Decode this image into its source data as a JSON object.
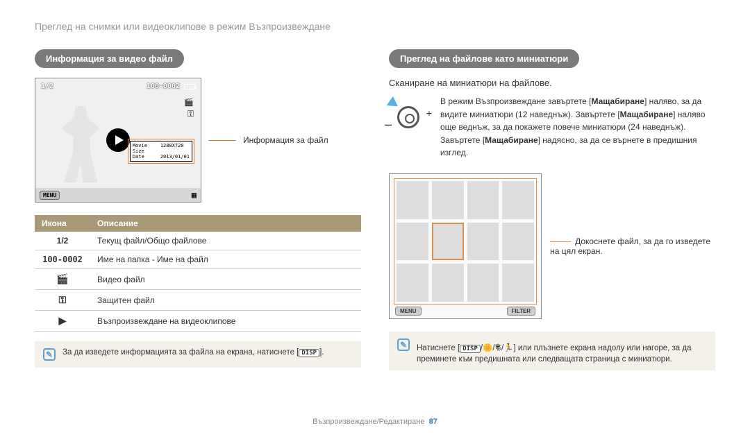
{
  "header": {
    "title": "Преглед на снимки или видеоклипове в режим Възпроизвеждане"
  },
  "left": {
    "section_title": "Информация за видео файл",
    "screen": {
      "counter": "1/2",
      "file_id": "100-0002",
      "info_rows": [
        {
          "label": "Movie Size",
          "value": "1280X720"
        },
        {
          "label": "Date",
          "value": "2013/01/01"
        }
      ],
      "menu_label": "MENU"
    },
    "callout": "Информация за файл",
    "table": {
      "head_icon": "Икона",
      "head_desc": "Описание",
      "rows": [
        {
          "icon": "1/2",
          "desc": "Текущ файл/Общо файлове"
        },
        {
          "icon": "100-0002",
          "desc": "Име на папка - Име на файл"
        },
        {
          "icon": "video",
          "desc": "Видео файл"
        },
        {
          "icon": "lock",
          "desc": "Защитен файл"
        },
        {
          "icon": "play",
          "desc": "Възпроизвеждане на видеоклипове"
        }
      ]
    },
    "note": {
      "pre": "За да изведете информацията за файла на екрана, натиснете [",
      "chip": "DISP",
      "post": "]."
    }
  },
  "right": {
    "section_title": "Преглед на файлове като миниатюри",
    "subhead": "Сканиране на миниатюри на файлове.",
    "zoom_text": {
      "p1a": "В режим Възпроизвеждане завъртете [",
      "p1b": "Мащабиране",
      "p1c": "] наляво, за да видите миниатюри (12 наведнъж). Завъртете [",
      "p1d": "Мащабиране",
      "p1e": "] наляво още веднъж, за да покажете повече миниатюри (24 наведнъж). Завъртете [",
      "p1f": "Мащабиране",
      "p1g": "] надясно, за да се върнете в предишния изглед."
    },
    "thumb": {
      "menu_label": "MENU",
      "filter_label": "FILTER"
    },
    "thumb_callout": "Докоснете файл, за да го изведете на цял екран.",
    "note": {
      "pre": "Натиснете [",
      "chip": "DISP",
      "mid": "/🌼/🕏/🏃] или плъзнете екрана надолу или нагоре, за да преминете към предишната или следващата страница с миниатюри."
    }
  },
  "footer": {
    "text": "Възпроизвеждане/Редактиране",
    "page": "87"
  }
}
